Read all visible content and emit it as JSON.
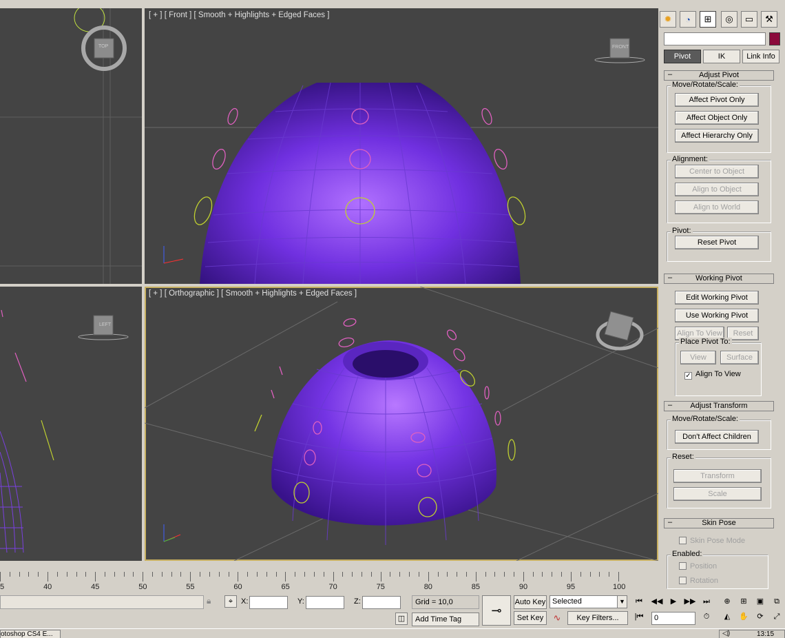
{
  "viewports": {
    "front_label": "[ + ] [ Front ] [ Smooth + Highlights + Edged Faces ]",
    "ortho_label": "[ + ] [ Orthographic ] [ Smooth + Highlights + Edged Faces ]",
    "top_cube": "TOP",
    "front_cube": "FRONT",
    "left_cube": "LEFT"
  },
  "command_panel": {
    "tabs": [
      "create-icon",
      "modify-icon",
      "hierarchy-icon",
      "motion-icon",
      "display-icon",
      "utilities-icon"
    ],
    "name_value": "",
    "object_color": "#8b0a3c",
    "hierarchy_tabs": [
      "Pivot",
      "IK",
      "Link Info"
    ],
    "adjust_pivot": {
      "title": "Adjust Pivot",
      "move_group": "Move/Rotate/Scale:",
      "affect_pivot": "Affect Pivot Only",
      "affect_object": "Affect Object Only",
      "affect_hierarchy": "Affect Hierarchy Only",
      "alignment_group": "Alignment:",
      "center_to_object": "Center to Object",
      "align_to_object": "Align to Object",
      "align_to_world": "Align to World",
      "pivot_group": "Pivot:",
      "reset_pivot": "Reset Pivot"
    },
    "working_pivot": {
      "title": "Working Pivot",
      "edit": "Edit Working Pivot",
      "use": "Use Working Pivot",
      "align_to_view": "Align To View",
      "reset": "Reset",
      "place_group": "Place Pivot To:",
      "view": "View",
      "surface": "Surface",
      "align_to_view_chk": "Align To View"
    },
    "adjust_transform": {
      "title": "Adjust Transform",
      "move_group": "Move/Rotate/Scale:",
      "dont_affect": "Don't Affect Children",
      "reset_group": "Reset:",
      "transform": "Transform",
      "scale": "Scale"
    },
    "skin_pose": {
      "title": "Skin Pose",
      "mode": "Skin Pose Mode",
      "enabled_group": "Enabled:",
      "position": "Position",
      "rotation": "Rotation"
    }
  },
  "timeline": {
    "labels": [
      "5",
      "40",
      "45",
      "50",
      "55",
      "60",
      "65",
      "70",
      "75",
      "80",
      "85",
      "90",
      "95",
      "100"
    ]
  },
  "status": {
    "x_label": "X:",
    "y_label": "Y:",
    "z_label": "Z:",
    "x_value": "",
    "y_value": "",
    "z_value": "",
    "grid": "Grid = 10,0",
    "add_time_tag": "Add Time Tag",
    "auto_key": "Auto Key",
    "set_key": "Set Key",
    "selected": "Selected",
    "key_filters": "Key Filters...",
    "frame_value": "0",
    "taskbar_app": "otoshop CS4 E...",
    "clock": "13:15"
  }
}
